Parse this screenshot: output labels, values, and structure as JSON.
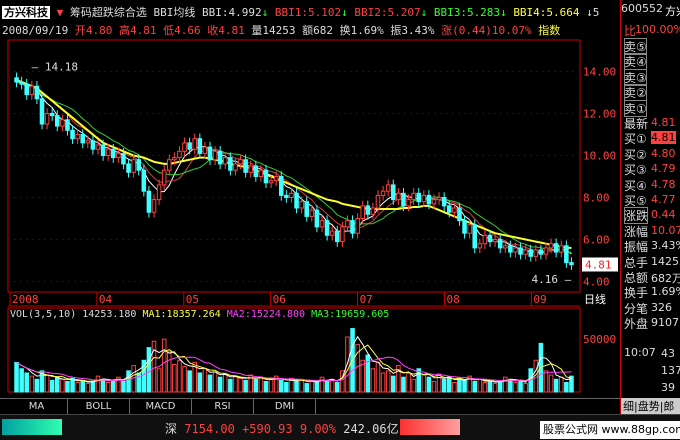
{
  "header": {
    "stock_name": "方兴科技",
    "indicator_name": "筹码超跌综合选",
    "bbi_title": "BBI均线",
    "bbi": "BBI:4.992",
    "bbi1": "BBI1:5.102",
    "bbi2": "BBI2:5.207",
    "bbi3": "BBI3:5.283",
    "bbi4": "BBI4:5.664",
    "tail": "↓5",
    "date": "2008/09/19",
    "open": "开4.80",
    "high": "高4.81",
    "low": "低4.66",
    "close": "收4.81",
    "vol": "量14253",
    "amount": "额682",
    "turnover": "换1.69%",
    "amplitude": "振3.43%",
    "change": "涨(0.44)10.07%",
    "index_btn": "指数"
  },
  "price_panel": {
    "y_ticks": [
      "14.00",
      "12.00",
      "10.00",
      "8.00",
      "6.00",
      "4.00"
    ],
    "high_label": "14.18",
    "low_label": "4.16",
    "last_price": "4.81",
    "x_ticks": [
      "2008",
      "04",
      "05",
      "06",
      "07",
      "08",
      "09"
    ],
    "period_label": "日线",
    "ylim": [
      3.5,
      15.5
    ],
    "colors": {
      "up": "#ff4040",
      "down": "#40ffff",
      "bbi": "#ffff30",
      "ma_w": "#ffffff",
      "ma_r": "#d04040",
      "ma_g": "#30d030"
    }
  },
  "volume_panel": {
    "title": "VOL(3,5,10)",
    "vol_value": "14253.180",
    "ma1": "MA1:18357.264",
    "ma2": "MA2:15224.800",
    "ma3": "MA3:19659.605",
    "y_ticks": [
      "50000"
    ],
    "ylim": [
      0,
      70000
    ]
  },
  "sidebar": {
    "code": "600552",
    "name_short": "方兴",
    "ratio": "100.00%",
    "rows": [
      {
        "label": "卖⑤",
        "value": ""
      },
      {
        "label": "卖④",
        "value": ""
      },
      {
        "label": "卖③",
        "value": ""
      },
      {
        "label": "卖②",
        "value": ""
      },
      {
        "label": "卖①",
        "value": ""
      },
      {
        "label": "最新",
        "value": "4.81"
      },
      {
        "label": "买①",
        "value": "4.81"
      },
      {
        "label": "买②",
        "value": "4.80"
      },
      {
        "label": "买③",
        "value": "4.79"
      },
      {
        "label": "买④",
        "value": "4.78"
      },
      {
        "label": "买⑤",
        "value": "4.77"
      },
      {
        "label": "涨跌",
        "value": "0.44"
      },
      {
        "label": "涨幅",
        "value": "10.07%"
      },
      {
        "label": "振幅",
        "value": "3.43%"
      },
      {
        "label": "总手",
        "value": "14253"
      },
      {
        "label": "总额",
        "value": "682万"
      },
      {
        "label": "换手",
        "value": "1.69%"
      },
      {
        "label": "分笔",
        "value": "326"
      },
      {
        "label": "外盘",
        "value": "9107"
      }
    ],
    "ticks": [
      {
        "time": "10:07",
        "value": "43"
      },
      {
        "time": "",
        "value": "137"
      },
      {
        "time": "",
        "value": "39"
      }
    ],
    "bottom_tab": "细|盘势|郎"
  },
  "tabs": [
    "MA",
    "BOLL",
    "MACD",
    "RSI",
    "DMI"
  ],
  "status": {
    "market": "深",
    "index": "7154.00",
    "change": "+590.93",
    "pct": "9.00%",
    "amount": "242.06亿",
    "watermark": "股票公式网 www.88gp.com"
  },
  "chart_data": {
    "type": "candlestick",
    "title": "方兴科技 BBI均线",
    "close": [
      13.5,
      13.4,
      12.9,
      13.3,
      12.7,
      11.5,
      12.0,
      11.9,
      11.4,
      11.7,
      11.2,
      10.8,
      11.0,
      10.6,
      10.7,
      10.3,
      10.5,
      10.0,
      10.3,
      9.9,
      10.1,
      9.6,
      9.2,
      9.8,
      9.3,
      8.3,
      7.3,
      7.9,
      8.6,
      9.3,
      9.8,
      9.9,
      10.2,
      10.6,
      10.3,
      10.8,
      10.1,
      10.4,
      9.8,
      10.2,
      9.6,
      9.9,
      9.3,
      9.6,
      9.8,
      9.2,
      9.5,
      9.0,
      9.3,
      8.7,
      8.8,
      9.0,
      8.1,
      8.0,
      8.2,
      7.5,
      7.8,
      7.1,
      7.4,
      6.6,
      6.9,
      6.2,
      6.4,
      5.9,
      6.6,
      6.9,
      6.3,
      7.0,
      7.6,
      7.2,
      7.5,
      8.1,
      8.3,
      8.6,
      7.9,
      8.2,
      7.6,
      7.9,
      8.2,
      7.8,
      8.1,
      7.7,
      7.9,
      8.0,
      7.6,
      7.3,
      7.5,
      6.9,
      6.3,
      6.7,
      5.6,
      5.8,
      6.2,
      5.9,
      6.0,
      5.6,
      5.7,
      5.4,
      5.6,
      5.3,
      5.5,
      5.2,
      5.5,
      5.3,
      5.6,
      5.8,
      5.4,
      5.7,
      4.9,
      4.8
    ],
    "bbi_line": [
      13.6,
      13.5,
      13.4,
      13.3,
      13.2,
      13.0,
      12.8,
      12.6,
      12.4,
      12.2,
      12.0,
      11.8,
      11.6,
      11.4,
      11.2,
      11.0,
      10.8,
      10.6,
      10.5,
      10.4,
      10.3,
      10.2,
      10.1,
      10.0,
      9.95,
      9.9,
      9.8,
      9.7,
      9.65,
      9.6,
      9.6,
      9.65,
      9.7,
      9.75,
      9.8,
      9.85,
      9.9,
      9.9,
      9.85,
      9.8,
      9.75,
      9.7,
      9.6,
      9.55,
      9.5,
      9.45,
      9.4,
      9.3,
      9.2,
      9.1,
      9.0,
      8.9,
      8.8,
      8.7,
      8.6,
      8.5,
      8.4,
      8.3,
      8.2,
      8.1,
      8.0,
      7.9,
      7.85,
      7.8,
      7.7,
      7.65,
      7.6,
      7.55,
      7.5,
      7.45,
      7.45,
      7.45,
      7.45,
      7.45,
      7.45,
      7.45,
      7.5,
      7.5,
      7.55,
      7.55,
      7.6,
      7.6,
      7.5,
      7.4,
      7.3,
      7.2,
      7.1,
      7.0,
      6.9,
      6.8,
      6.7,
      6.6,
      6.5,
      6.4,
      6.3,
      6.25,
      6.2,
      6.15,
      6.1,
      6.05,
      6.0,
      5.95,
      5.9,
      5.85,
      5.8,
      5.75,
      5.7,
      5.65,
      5.6,
      5.6
    ],
    "volume": [
      28000,
      22000,
      18000,
      15000,
      12000,
      20000,
      16000,
      11000,
      14000,
      12000,
      10000,
      13000,
      9000,
      11000,
      8000,
      10000,
      15000,
      12000,
      9000,
      11000,
      14000,
      10000,
      20000,
      25000,
      18000,
      30000,
      42000,
      48000,
      22000,
      50000,
      38000,
      26000,
      30000,
      24000,
      20000,
      28000,
      18000,
      22000,
      16000,
      19000,
      14000,
      17000,
      12000,
      15000,
      13000,
      11000,
      16000,
      12000,
      14000,
      10000,
      12000,
      15000,
      11000,
      9000,
      13000,
      10000,
      12000,
      8000,
      11000,
      9000,
      14000,
      10000,
      12000,
      9000,
      20000,
      52000,
      60000,
      45000,
      30000,
      35000,
      22000,
      28000,
      18000,
      20000,
      15000,
      25000,
      14000,
      18000,
      12000,
      22000,
      16000,
      14000,
      10000,
      17000,
      12000,
      14000,
      9000,
      13000,
      11000,
      15000,
      10000,
      12000,
      9000,
      11000,
      8000,
      10000,
      14000,
      12000,
      9000,
      11000,
      8000,
      22000,
      30000,
      46000,
      20000,
      16000,
      12000,
      14000,
      9000,
      15000
    ]
  }
}
